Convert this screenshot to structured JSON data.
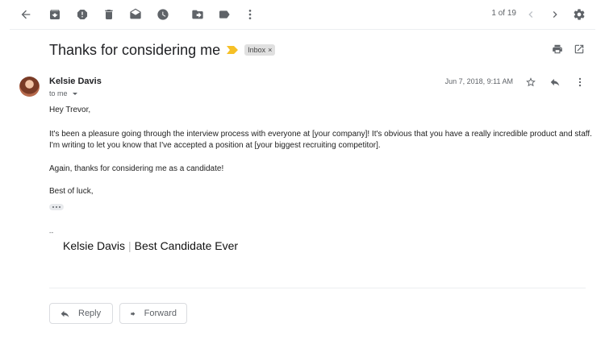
{
  "toolbar": {
    "back_icon": "arrow-left-icon",
    "archive_icon": "archive-icon",
    "spam_icon": "report-spam-icon",
    "delete_icon": "trash-icon",
    "unread_icon": "mark-unread-icon",
    "snooze_icon": "clock-icon",
    "move_icon": "move-to-folder-icon",
    "label_icon": "label-icon",
    "more_icon": "more-vertical-icon",
    "count": "1 of 19",
    "prev_icon": "chevron-left-icon",
    "next_icon": "chevron-right-icon",
    "settings_icon": "gear-icon"
  },
  "email": {
    "subject": "Thanks for considering me",
    "label": "Inbox",
    "label_remove": "×",
    "sender": "Kelsie Davis",
    "recipient": "to me",
    "date": "Jun 7, 2018, 9:11 AM",
    "body": {
      "greeting": "Hey Trevor,",
      "line1": "It's been a pleasure going through the interview process with everyone at [your company]! It's obvious that you have a really incredible product and staff.",
      "line2": "I'm writing to let you know that I've accepted a position at [your biggest recruiting competitor].",
      "line3": "Again, thanks for considering me as a candidate!",
      "closing": "Best of luck,"
    },
    "signature_dash": "--",
    "signature_name": "Kelsie Davis",
    "signature_separator": "|",
    "signature_title": "Best Candidate Ever"
  },
  "actions": {
    "reply_label": "Reply",
    "forward_label": "Forward"
  },
  "colors": {
    "importance": "#f6c026",
    "text": "#202124",
    "muted": "#5f6368"
  }
}
